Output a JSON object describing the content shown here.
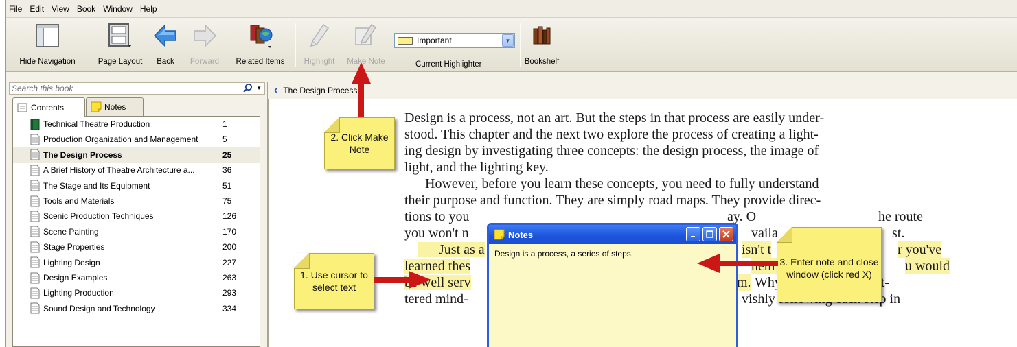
{
  "menu": [
    "File",
    "Edit",
    "View",
    "Book",
    "Window",
    "Help"
  ],
  "toolbar": {
    "hide_navigation": "Hide Navigation",
    "page_layout": "Page Layout",
    "back": "Back",
    "forward": "Forward",
    "related_items": "Related Items",
    "highlight": "Highlight",
    "make_note": "Make Note",
    "highlighter_value": "Important",
    "current_highlighter": "Current Highlighter",
    "bookshelf": "Bookshelf"
  },
  "search": {
    "placeholder": "Search this book"
  },
  "tabs": {
    "contents": "Contents",
    "notes": "Notes"
  },
  "toc": [
    {
      "title": "Technical Theatre Production",
      "page": "1"
    },
    {
      "title": "Production Organization and Management",
      "page": "5"
    },
    {
      "title": "The Design Process",
      "page": "25"
    },
    {
      "title": "A Brief History of Theatre Architecture a...",
      "page": "36"
    },
    {
      "title": "The Stage and Its Equipment",
      "page": "51"
    },
    {
      "title": "Tools and Materials",
      "page": "75"
    },
    {
      "title": "Scenic Production Techniques",
      "page": "126"
    },
    {
      "title": "Scene Painting",
      "page": "170"
    },
    {
      "title": "Stage Properties",
      "page": "200"
    },
    {
      "title": "Lighting Design",
      "page": "227"
    },
    {
      "title": "Design Examples",
      "page": "263"
    },
    {
      "title": "Lighting Production",
      "page": "293"
    },
    {
      "title": "Sound Design and Technology",
      "page": "334"
    }
  ],
  "breadcrumb": "The Design Process",
  "book_text": {
    "l1": "Design is a process, not an art. But the steps in that process are easily under-",
    "l2": "stood. This chapter and the next two explore the process of creating a light-",
    "l3": "ing design by investigating three concepts: the design process, the image of",
    "l4": "light, and the lighting key.",
    "l5": "However, before you learn these concepts, you need to fully understand",
    "l6": "their purpose and function. They are simply road maps. They provide direc-",
    "l7": "tions to you",
    "l7b": "ay. O",
    "l7c": "he route",
    "l8": "you won't n",
    "l8b": "vaila",
    "l8c": "st.",
    "l9": "Just as a",
    "l9b": "isn't t",
    "l9c": "r you've",
    "l10": "learned thes",
    "l10b": "hem se",
    "l10c": "u would",
    "l11": "be well serv",
    "l11b": "m.",
    "l11c": " Why? Because an unfet-",
    "l12": "tered mind-",
    "l12b": "vishly following each step in"
  },
  "notes_window": {
    "title": "Notes",
    "text": "Design is a process, a series of steps."
  },
  "callouts": {
    "c1": "1.  Use cursor to select text",
    "c2": "2. Click Make Note",
    "c3": "3.  Enter note and close window (click red X)"
  },
  "colors": {
    "callout_yellow": "#fbf07a",
    "arrow_red": "#cc1717",
    "highlight": "#fbf3a4",
    "xp_blue": "#2d5ee0"
  }
}
